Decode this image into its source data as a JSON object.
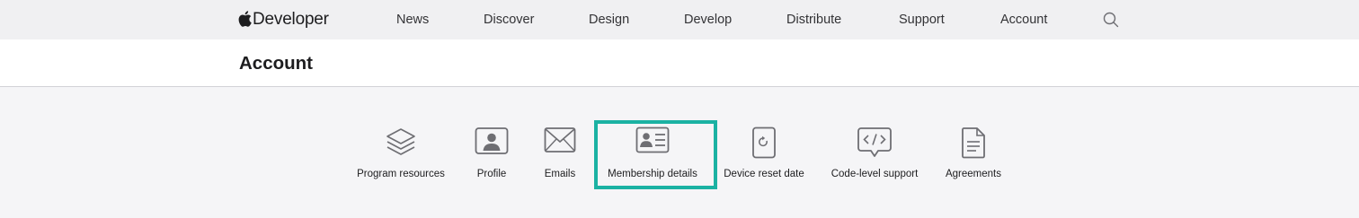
{
  "globalnav": {
    "brand": "Developer",
    "links": [
      "News",
      "Discover",
      "Design",
      "Develop",
      "Distribute",
      "Support",
      "Account"
    ],
    "search_icon": "search-icon"
  },
  "subnav": {
    "title": "Account"
  },
  "tiles": [
    {
      "label": "Program resources",
      "icon": "stack-icon"
    },
    {
      "label": "Profile",
      "icon": "profile-card-icon"
    },
    {
      "label": "Emails",
      "icon": "envelope-icon"
    },
    {
      "label": "Membership details",
      "icon": "membership-card-icon",
      "highlighted": true
    },
    {
      "label": "Device reset date",
      "icon": "device-reset-icon"
    },
    {
      "label": "Code-level support",
      "icon": "code-bubble-icon"
    },
    {
      "label": "Agreements",
      "icon": "document-icon"
    }
  ],
  "colors": {
    "highlight": "#1bb2a3",
    "nav_bg": "#f0f0f2",
    "page_bg": "#f5f5f7"
  }
}
